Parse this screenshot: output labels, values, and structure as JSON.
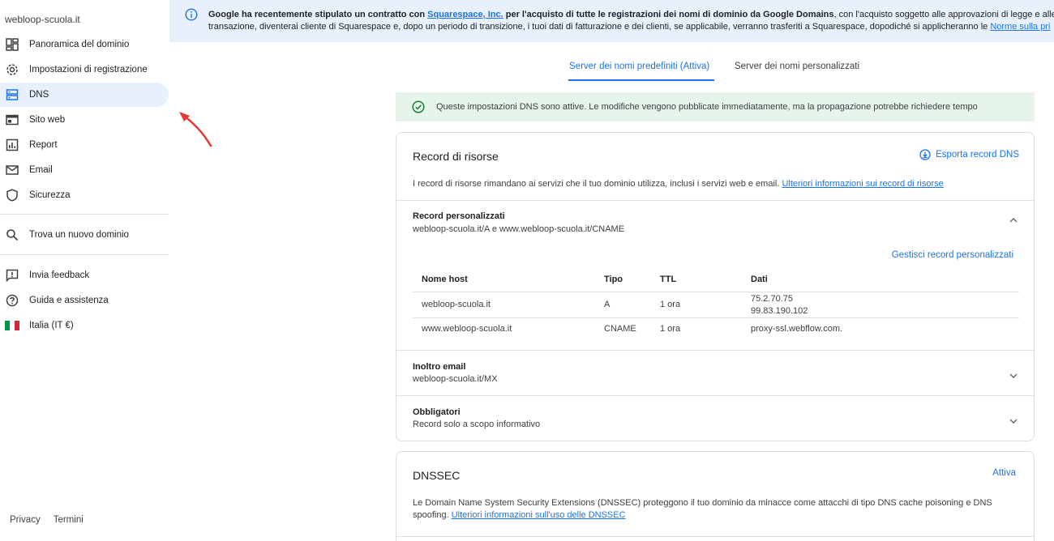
{
  "sidebar": {
    "domain": "webloop-scuola.it",
    "items": [
      {
        "label": "Panoramica del dominio",
        "icon": "dashboard-icon"
      },
      {
        "label": "Impostazioni di registrazione",
        "icon": "gear-icon"
      },
      {
        "label": "DNS",
        "icon": "dns-icon"
      },
      {
        "label": "Sito web",
        "icon": "web-icon"
      },
      {
        "label": "Report",
        "icon": "report-icon"
      },
      {
        "label": "Email",
        "icon": "email-icon"
      },
      {
        "label": "Sicurezza",
        "icon": "shield-icon"
      }
    ],
    "find_domain": "Trova un nuovo dominio",
    "feedback": "Invia feedback",
    "help": "Guida e assistenza",
    "region": "Italia (IT €)",
    "footer": {
      "privacy": "Privacy",
      "terms": "Termini"
    }
  },
  "banner": {
    "bold_1": "Google ha recentemente stipulato un contratto con ",
    "link_1": "Squarespace, Inc.",
    "bold_2": " per l'acquisto di tutte le registrazioni dei nomi di dominio da Google Domains",
    "text_1": ", con l'acquisto soggetto alle approvazioni di legge e alle consue",
    "text_2": "transazione, diventerai cliente di Squarespace e, dopo un periodo di transizione, i tuoi dati di fatturazione e dei clienti, se applicabile, verranno trasferiti a Squarespace, dopodiché si applicheranno le ",
    "link_2": "Norme sulla pri"
  },
  "tabs": {
    "default": "Server dei nomi predefiniti (Attiva)",
    "custom": "Server dei nomi personalizzati"
  },
  "success_msg": "Queste impostazioni DNS sono attive. Le modifiche vengono pubblicate immediatamente, ma la propagazione potrebbe richiedere tempo",
  "resource_records": {
    "title": "Record di risorse",
    "export": "Esporta record DNS",
    "desc": "I record di risorse rimandano ai servizi che il tuo dominio utilizza, inclusi i servizi web e email. ",
    "desc_link": "Ulteriori informazioni sui record di risorse",
    "custom": {
      "title": "Record personalizzati",
      "sub": "webloop-scuola.it/A e www.webloop-scuola.it/CNAME",
      "manage": "Gestisci record personalizzati",
      "headers": {
        "host": "Nome host",
        "type": "Tipo",
        "ttl": "TTL",
        "data": "Dati"
      },
      "rows": [
        {
          "host": "webloop-scuola.it",
          "type": "A",
          "ttl": "1 ora",
          "data_1": "75.2.70.75",
          "data_2": "99.83.190.102"
        },
        {
          "host": "www.webloop-scuola.it",
          "type": "CNAME",
          "ttl": "1 ora",
          "data_1": "proxy-ssl.webflow.com."
        }
      ]
    },
    "email_fwd": {
      "title": "Inoltro email",
      "sub": "webloop-scuola.it/MX"
    },
    "required": {
      "title": "Obbligatori",
      "sub": "Record solo a scopo informativo"
    }
  },
  "dnssec": {
    "title": "DNSSEC",
    "action": "Attiva",
    "desc_1": "Le Domain Name System Security Extensions (DNSSEC) proteggono il tuo dominio da minacce come attacchi di tipo DNS cache poisoning e DNS",
    "desc_2": "spoofing. ",
    "desc_link": "Ulteriori informazioni sull'uso delle DNSSEC"
  },
  "colors": {
    "accent": "#1a73e8",
    "active_bg": "#e8f0fe",
    "success_bg": "#e6f4ea",
    "success_icon": "#188038",
    "annotation": "#e53935"
  }
}
